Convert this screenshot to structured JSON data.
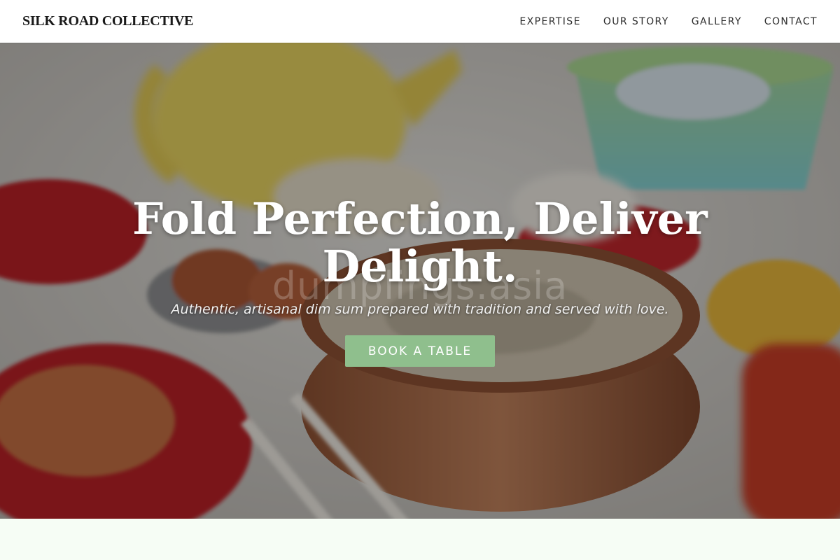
{
  "header": {
    "brand": "SILK ROAD COLLECTIVE",
    "nav": [
      {
        "label": "EXPERTISE"
      },
      {
        "label": "OUR STORY"
      },
      {
        "label": "GALLERY"
      },
      {
        "label": "CONTACT"
      }
    ]
  },
  "hero": {
    "title": "Fold Perfection, Deliver Delight.",
    "subtitle": "Authentic, artisanal dim sum prepared with tradition and served with love.",
    "watermark": "dumplings.asia",
    "cta_label": "BOOK A TABLE",
    "image_icon": "dim-sum-table-photo"
  },
  "colors": {
    "accent": "#8fbf8d",
    "header_bg": "#ffffff",
    "page_bg": "#f6fdf5"
  }
}
